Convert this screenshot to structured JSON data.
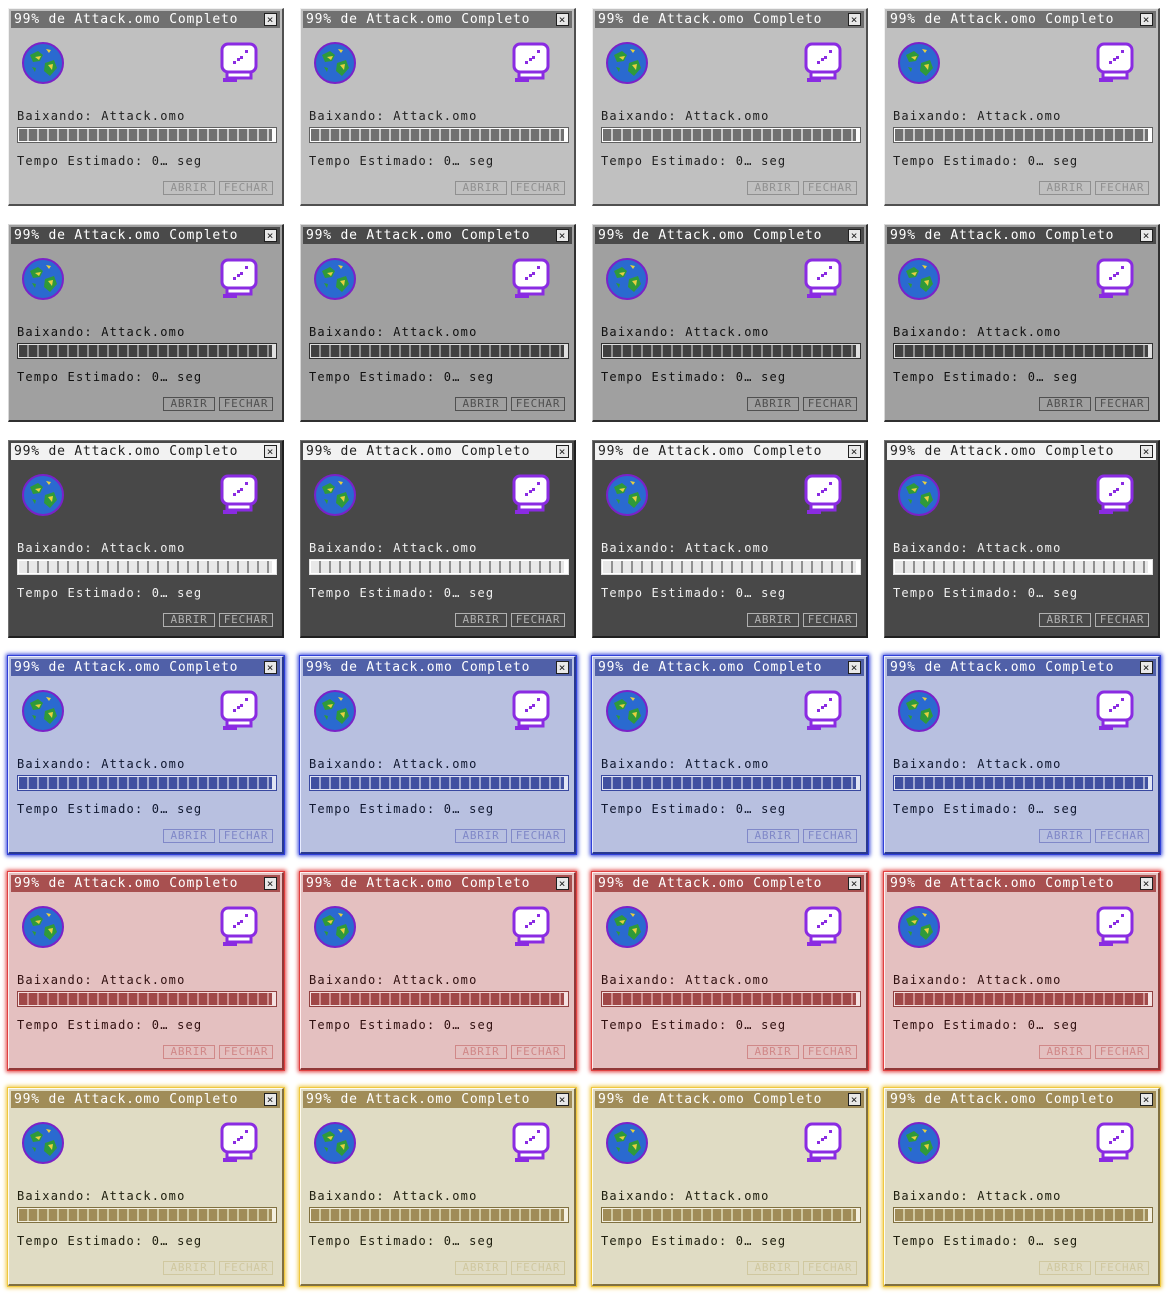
{
  "window": {
    "title": "99% de Attack.omo Completo",
    "close_glyph": "×",
    "downloading_label": "Baixando: Attack.omo",
    "eta_label": "Tempo Estimado: 0… seg",
    "open_button": "ABRIR",
    "close_button": "FECHAR",
    "progress_percent": 99,
    "icons": [
      "globe-icon",
      "smiley-document-icon"
    ]
  },
  "themes": {
    "gray": {
      "body": "#c0c0c0",
      "title": "#707070",
      "text": "#202020",
      "seg": "#707070",
      "barbg": "#ffffff",
      "gap": "#c8c8c8",
      "bb": "#606060",
      "btnb": "#909090",
      "btnt": "#909090",
      "hi": "#f0f0f0",
      "sh": "#505050",
      "glow": ""
    },
    "mono": {
      "body": "#a0a0a0",
      "title": "#4a4a4a",
      "text": "#101010",
      "seg": "#404040",
      "barbg": "#e0e0e0",
      "gap": "#909090",
      "bb": "#303030",
      "btnb": "#505050",
      "btnt": "#505050",
      "hi": "#d8d8d8",
      "sh": "#303030",
      "glow": ""
    },
    "dark": {
      "body": "#484848",
      "title": "#f2f2f2",
      "text": "#f0f0f0",
      "seg": "#e8e8e8",
      "barbg": "#ffffff",
      "gap": "#909090",
      "bb": "#e0e0e0",
      "btnb": "#b0b0b0",
      "btnt": "#b0b0b0",
      "hi": "#707070",
      "sh": "#202020",
      "glow": ""
    },
    "blue": {
      "body": "#b8c0e0",
      "title": "#5060a8",
      "text": "#101830",
      "seg": "#4050a0",
      "barbg": "#e0e4f4",
      "gap": "#a0a8d0",
      "bb": "#3848a0",
      "btnb": "#8088c8",
      "btnt": "#8088c8",
      "hi": "#e8ecff",
      "sh": "#283890",
      "glow": "#3040d8"
    },
    "red": {
      "body": "#e4c0c0",
      "title": "#a85050",
      "text": "#301010",
      "seg": "#a04848",
      "barbg": "#f4e0e0",
      "gap": "#d09090",
      "bb": "#904040",
      "btnb": "#d08888",
      "btnt": "#d08888",
      "hi": "#fff0f0",
      "sh": "#903838",
      "glow": "#e04040"
    },
    "yellow": {
      "body": "#e0dcc4",
      "title": "#a08c58",
      "text": "#202010",
      "seg": "#a08c58",
      "barbg": "#f4f0e0",
      "gap": "#d0c8a0",
      "bb": "#807040",
      "btnb": "#d0c8a0",
      "btnt": "#d0c8a0",
      "hi": "#fffcf0",
      "sh": "#807040",
      "glow": "#f0c840"
    }
  },
  "grid": {
    "rows": [
      "gray",
      "mono",
      "dark",
      "blue",
      "red",
      "yellow"
    ],
    "columns": 4
  }
}
